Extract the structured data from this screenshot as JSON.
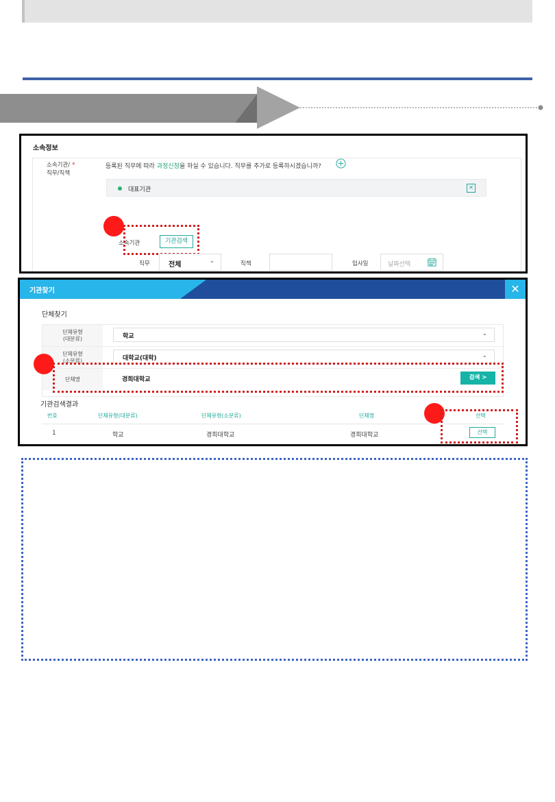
{
  "colors": {
    "accent_teal": "#20a899",
    "search_button": "#16b3a6",
    "header_blue": "#3f63a8",
    "modal_blue_light": "#28b5ea",
    "modal_blue_dark": "#1f4f9c",
    "highlight_red": "#d01e1e",
    "note_border_blue": "#3b63c4"
  },
  "affiliation_panel": {
    "section_title": "소속정보",
    "field_label_line1": "소속기관/",
    "field_label_required": "*",
    "field_label_line2": "직무/직책",
    "description_before": "등록된 직무에 따라 ",
    "description_link": "과정신청",
    "description_after": "을 하실 수 있습니다. 직무를 추가로 등록하시겠습니까?",
    "plus_icon": "circle-plus-icon",
    "representative_label": "대표기관",
    "close_icon": "close-box-icon",
    "affiliation_label": "소속기관",
    "agency_search_button": "기관검색",
    "job_label": "직무",
    "job_value": "전체",
    "position_label": "직책",
    "position_value": "",
    "hire_date_label": "입사일",
    "hire_date_placeholder": "날짜선택",
    "calendar_icon": "calendar-icon"
  },
  "agency_modal": {
    "title": "기관찾기",
    "close_label": "✕",
    "find_title": "단체찾기",
    "major_type_label_line1": "단체유형",
    "major_type_label_line2": "(대분류)",
    "major_type_value": "학교",
    "minor_type_label_line1": "단체유형",
    "minor_type_label_line2": "(소분류)",
    "minor_type_value": "대학교(대학)",
    "name_label": "단체명",
    "name_value": "경희대학교",
    "search_button": "검색 >",
    "results_title": "기관검색결과",
    "columns": [
      "번호",
      "단체유형(대분류)",
      "단체유형(소분류)",
      "단체명",
      "선택"
    ],
    "rows": [
      {
        "no": "1",
        "major": "학교",
        "minor": "경희대학교",
        "name": "경희대학교",
        "action": "선택"
      }
    ]
  }
}
